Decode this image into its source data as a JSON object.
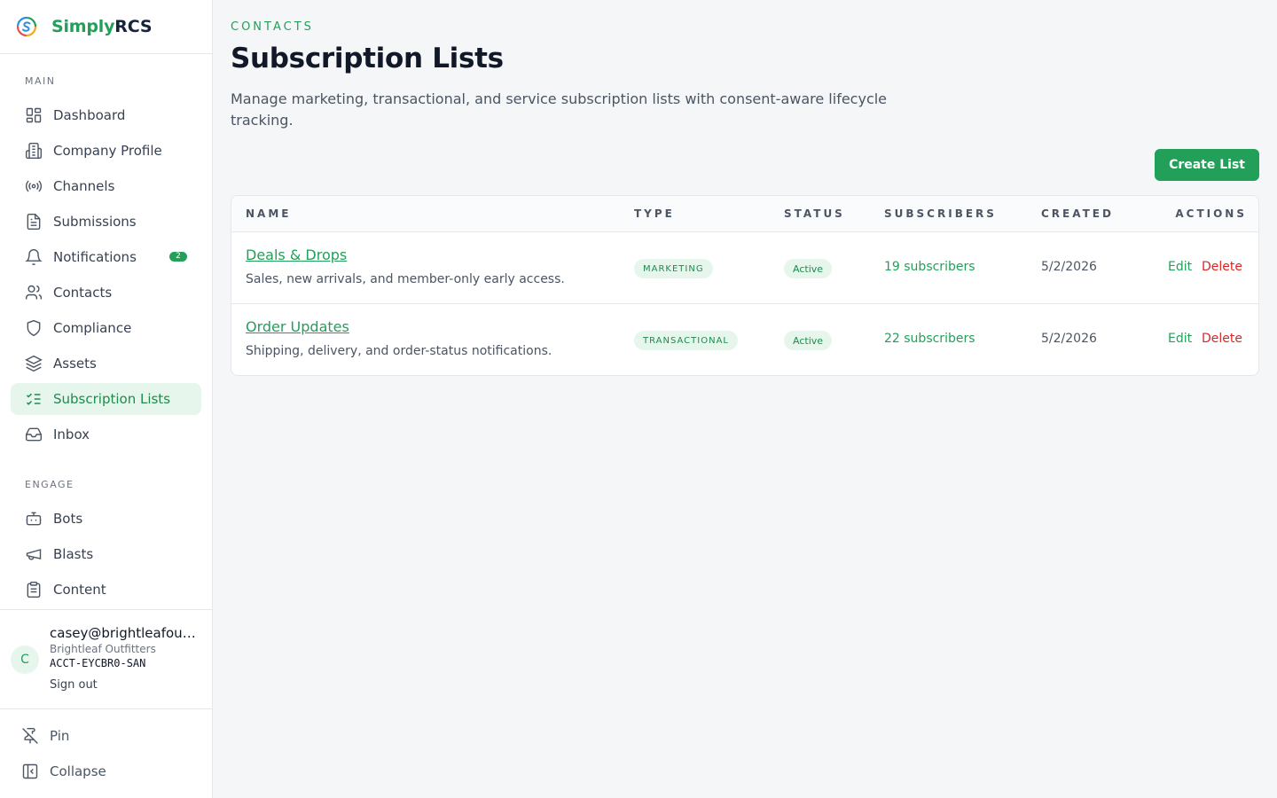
{
  "brand": {
    "part1": "Simply",
    "part2": "RCS"
  },
  "sidebar": {
    "sections": [
      {
        "label": "MAIN"
      },
      {
        "label": "ENGAGE"
      }
    ],
    "items": [
      {
        "label": "Dashboard",
        "icon": "dashboard-icon"
      },
      {
        "label": "Company Profile",
        "icon": "building-icon"
      },
      {
        "label": "Channels",
        "icon": "broadcast-icon"
      },
      {
        "label": "Submissions",
        "icon": "file-icon"
      },
      {
        "label": "Notifications",
        "icon": "bell-icon",
        "badge": "2"
      },
      {
        "label": "Contacts",
        "icon": "users-icon"
      },
      {
        "label": "Compliance",
        "icon": "shield-icon"
      },
      {
        "label": "Assets",
        "icon": "layers-icon"
      },
      {
        "label": "Subscription Lists",
        "icon": "list-checks-icon",
        "active": true
      },
      {
        "label": "Inbox",
        "icon": "inbox-icon"
      },
      {
        "label": "Bots",
        "icon": "bot-icon"
      },
      {
        "label": "Blasts",
        "icon": "megaphone-icon"
      },
      {
        "label": "Content",
        "icon": "clipboard-icon"
      }
    ],
    "user": {
      "initial": "C",
      "email": "casey@brightleafoutfitters.com",
      "company": "Brightleaf Outfitters",
      "account": "ACCT-EYCBR0-SAN",
      "sign_out": "Sign out"
    },
    "footer": {
      "pin": "Pin",
      "collapse": "Collapse"
    }
  },
  "header": {
    "eyebrow": "CONTACTS",
    "title": "Subscription Lists",
    "description": "Manage marketing, transactional, and service subscription lists with consent-aware lifecycle tracking.",
    "create_button": "Create List"
  },
  "table": {
    "columns": [
      "NAME",
      "TYPE",
      "STATUS",
      "SUBSCRIBERS",
      "CREATED",
      "ACTIONS"
    ],
    "rows": [
      {
        "name": "Deals & Drops",
        "description": "Sales, new arrivals, and member-only early access.",
        "type": "MARKETING",
        "status": "Active",
        "subscribers": "19 subscribers",
        "created": "5/2/2026",
        "edit": "Edit",
        "delete": "Delete"
      },
      {
        "name": "Order Updates",
        "description": "Shipping, delivery, and order-status notifications.",
        "type": "TRANSACTIONAL",
        "status": "Active",
        "subscribers": "22 subscribers",
        "created": "5/2/2026",
        "edit": "Edit",
        "delete": "Delete"
      }
    ]
  },
  "colors": {
    "accent": "#22a05a",
    "danger": "#dc2626",
    "active_bg": "#e6f6ec"
  }
}
